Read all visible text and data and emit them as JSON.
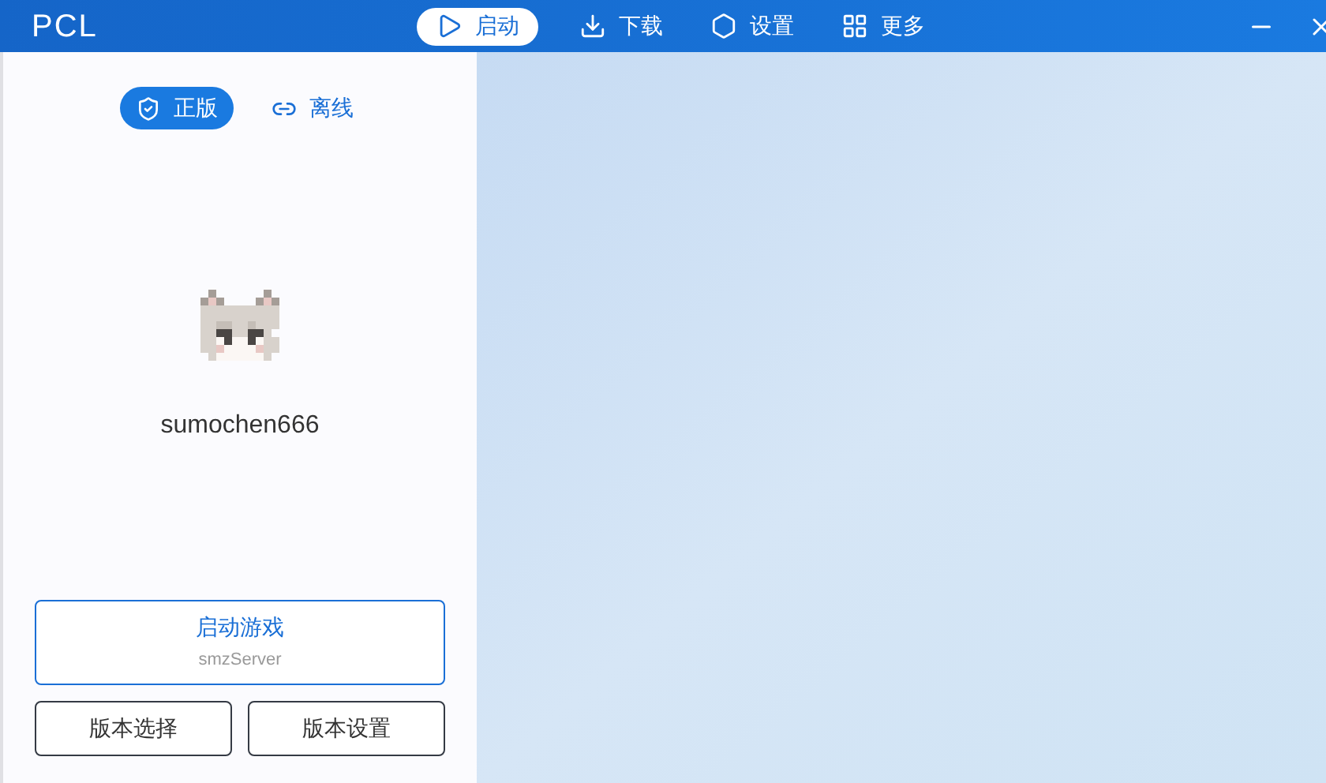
{
  "window": {
    "title": "PCL"
  },
  "nav": [
    {
      "label": "启动",
      "selected": true
    },
    {
      "label": "下载",
      "selected": false
    },
    {
      "label": "设置",
      "selected": false
    },
    {
      "label": "更多",
      "selected": false
    }
  ],
  "login_modes": [
    {
      "label": "正版",
      "selected": true
    },
    {
      "label": "离线",
      "selected": false
    }
  ],
  "username": "sumochen666",
  "launch_button": {
    "label": "启动游戏",
    "subtitle": "smzServer"
  },
  "buttons": [
    "版本选择",
    "版本设置"
  ]
}
